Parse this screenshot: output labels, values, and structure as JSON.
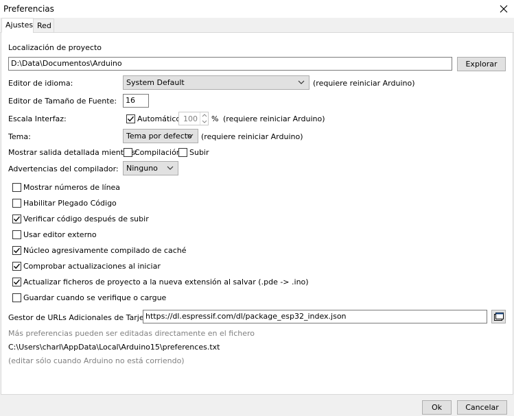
{
  "window": {
    "title": "Preferencias"
  },
  "tabs": [
    {
      "label": "Ajustes"
    },
    {
      "label": "Red"
    }
  ],
  "sketchbook": {
    "label": "Localización de proyecto",
    "path": "D:\\Data\\Documentos\\Arduino",
    "browse_label": "Explorar"
  },
  "language": {
    "label": "Editor de idioma:",
    "value": "System Default",
    "note": "(requiere reiniciar Arduino)"
  },
  "font_size": {
    "label": "Editor de Tamaño de Fuente:",
    "value": "16"
  },
  "scale": {
    "label": "Escala Interfaz:",
    "auto_label": "Automático",
    "auto_checked": true,
    "value": "100",
    "unit": "%",
    "note": "(requiere reiniciar Arduino)"
  },
  "theme": {
    "label": "Tema:",
    "value": "Tema por defecto",
    "note": "(requiere reiniciar Arduino)"
  },
  "verbose": {
    "label": "Mostrar salida detallada mientras:",
    "compile_label": "Compilación",
    "compile_checked": false,
    "upload_label": "Subir",
    "upload_checked": false
  },
  "warnings": {
    "label": "Advertencias del compilador:",
    "value": "Ninguno"
  },
  "options": [
    {
      "label": "Mostrar números de línea",
      "checked": false
    },
    {
      "label": "Habilitar Plegado Código",
      "checked": false
    },
    {
      "label": "Verificar código después de subir",
      "checked": true
    },
    {
      "label": "Usar editor externo",
      "checked": false
    },
    {
      "label": "Núcleo agresivamente compilado de caché",
      "checked": true
    },
    {
      "label": "Comprobar actualizaciones al iniciar",
      "checked": true
    },
    {
      "label": "Actualizar ficheros de proyecto a la nueva extensión al salvar (.pde -> .ino)",
      "checked": true
    },
    {
      "label": "Guardar cuando se verifique o cargue",
      "checked": false
    }
  ],
  "board_urls": {
    "label": "Gestor de URLs Adicionales de Tarjetas:",
    "value": "https://dl.espressif.com/dl/package_esp32_index.json"
  },
  "footer_info": {
    "more_prefs": "Más preferencias pueden ser editadas directamente en el fichero",
    "prefs_path": "C:\\Users\\charl\\AppData\\Local\\Arduino15\\preferences.txt",
    "edit_note": "(editar sólo cuando Arduino no está corriendo)"
  },
  "buttons": {
    "ok": "Ok",
    "cancel": "Cancelar"
  }
}
